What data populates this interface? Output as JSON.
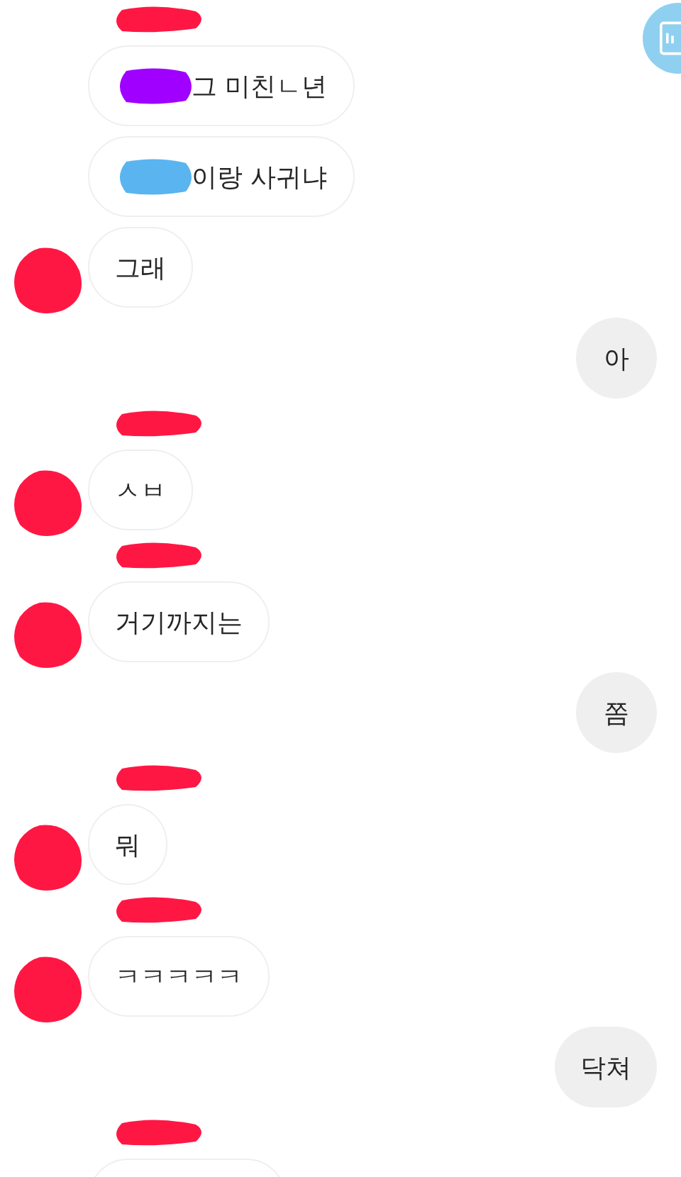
{
  "items": [
    {
      "kind": "name-mark"
    },
    {
      "kind": "incoming",
      "text": "그 미친ㄴ년",
      "avatar": false,
      "color": "#a000ff"
    },
    {
      "kind": "incoming",
      "text": "이랑 사귀냐",
      "avatar": false,
      "color": "#5ab4f0"
    },
    {
      "kind": "incoming",
      "text": "그래",
      "avatar": true
    },
    {
      "kind": "outgoing",
      "text": "아"
    },
    {
      "kind": "name-mark"
    },
    {
      "kind": "incoming",
      "text": "ㅅㅂ",
      "avatar": true
    },
    {
      "kind": "name-mark"
    },
    {
      "kind": "incoming",
      "text": "거기까지는",
      "avatar": true
    },
    {
      "kind": "outgoing",
      "text": "쫌"
    },
    {
      "kind": "name-mark"
    },
    {
      "kind": "incoming",
      "text": "뭐",
      "avatar": true
    },
    {
      "kind": "name-mark"
    },
    {
      "kind": "incoming",
      "text": "ㅋㅋㅋㅋㅋ",
      "avatar": true
    },
    {
      "kind": "outgoing",
      "text": "닥쳐"
    },
    {
      "kind": "name-mark"
    },
    {
      "kind": "partial-bubble"
    }
  ]
}
